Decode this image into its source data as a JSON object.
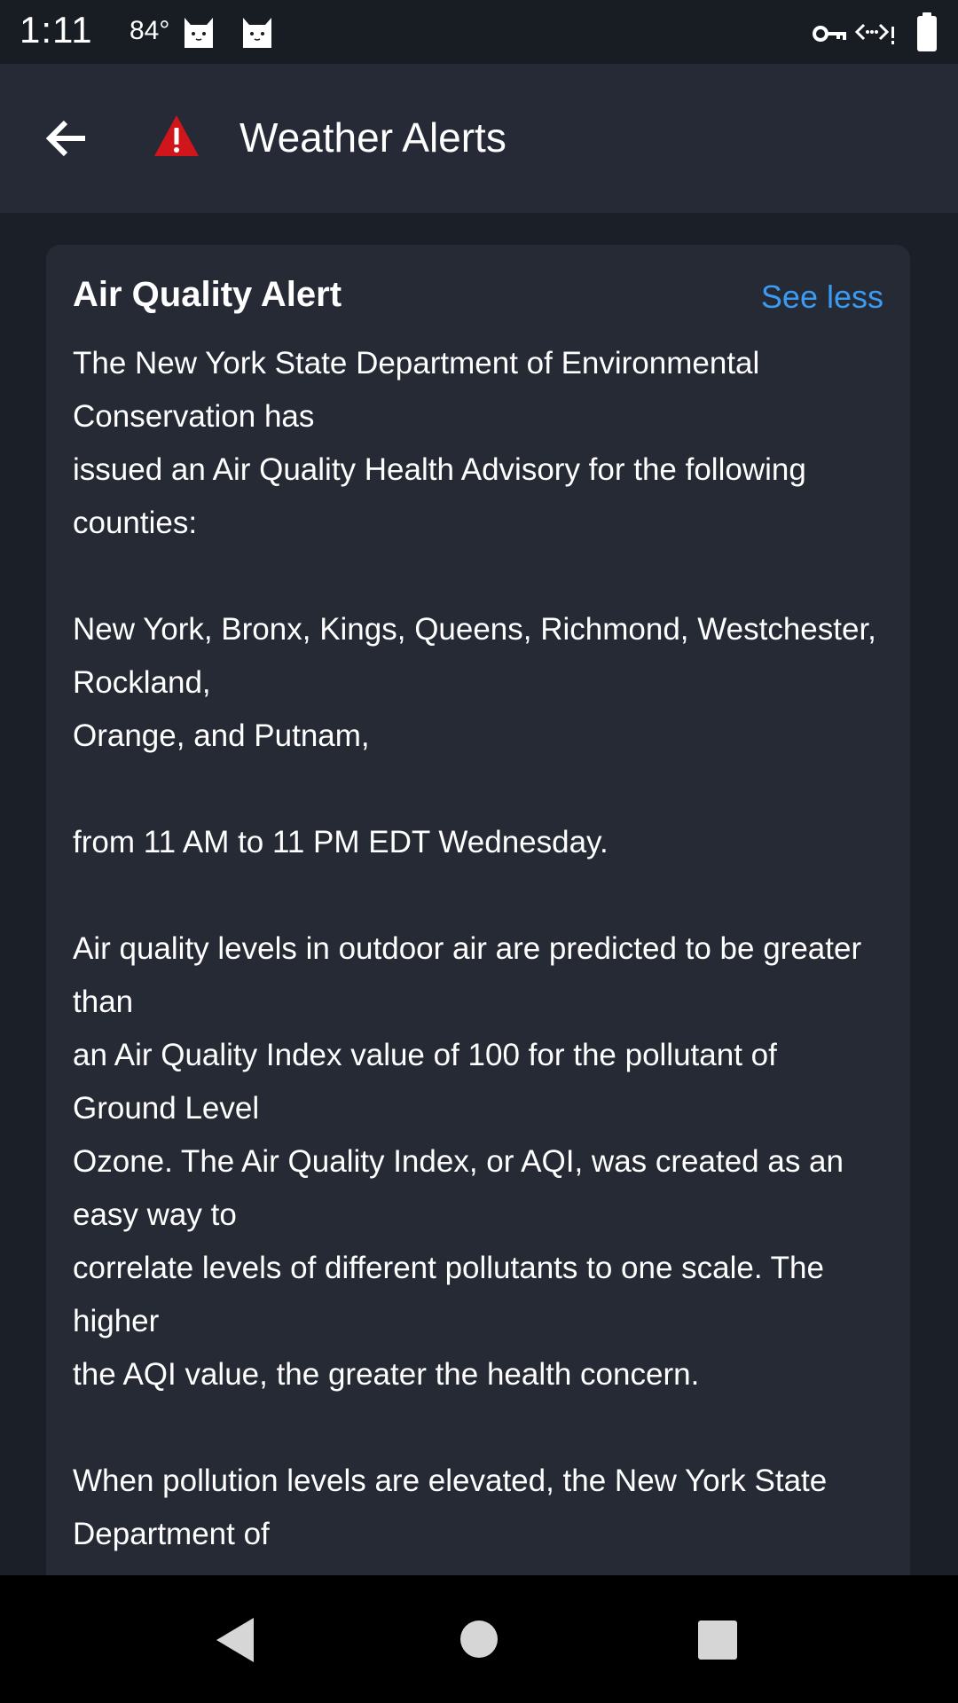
{
  "status_bar": {
    "time": "1:11",
    "temperature": "84°",
    "icons": [
      "cat-notification-icon",
      "cat-notification-icon",
      "vpn-key-icon",
      "data-saver-icon",
      "battery-icon"
    ]
  },
  "app_bar": {
    "title": "Weather Alerts",
    "back_icon": "arrow-left-icon",
    "alert_icon": "warning-icon",
    "alert_icon_color": "#d0161b"
  },
  "alert": {
    "title": "Air Quality Alert",
    "toggle_label": "See less",
    "toggle_color": "#3b9af2",
    "body": "The New York State Department of Environmental Conservation has\nissued an Air Quality Health Advisory for the following counties:\n\nNew York, Bronx, Kings, Queens, Richmond, Westchester, Rockland,\nOrange, and Putnam,\n\nfrom 11 AM to 11 PM EDT Wednesday.\n\nAir quality levels in outdoor air are predicted to be greater than\nan Air Quality Index value of 100 for the pollutant of Ground Level\nOzone. The Air Quality Index, or AQI, was created as an easy way to\ncorrelate levels of different pollutants to one scale. The higher\nthe AQI value, the greater the health concern.\n\nWhen pollution levels are elevated, the New York State Department of"
  },
  "nav_bar": {
    "buttons": [
      "back-triangle-icon",
      "home-circle-icon",
      "recents-square-icon"
    ]
  }
}
